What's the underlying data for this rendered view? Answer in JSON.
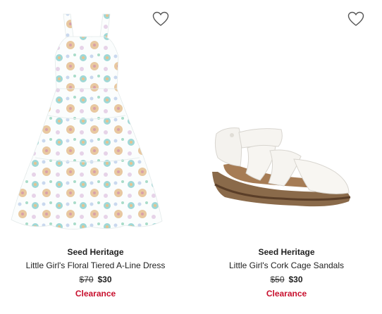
{
  "products": [
    {
      "brand": "Seed Heritage",
      "name": "Little Girl's Floral Tiered A-Line Dress",
      "original_price": "$70",
      "sale_price": "$30",
      "badge": "Clearance",
      "image": "floral-dress-image",
      "favorite_icon": "heart-outline-icon"
    },
    {
      "brand": "Seed Heritage",
      "name": "Little Girl's Cork Cage Sandals",
      "original_price": "$50",
      "sale_price": "$30",
      "badge": "Clearance",
      "image": "white-cage-sandal-image",
      "favorite_icon": "heart-outline-icon"
    }
  ],
  "colors": {
    "clearance": "#c8102e",
    "text": "#222222"
  }
}
